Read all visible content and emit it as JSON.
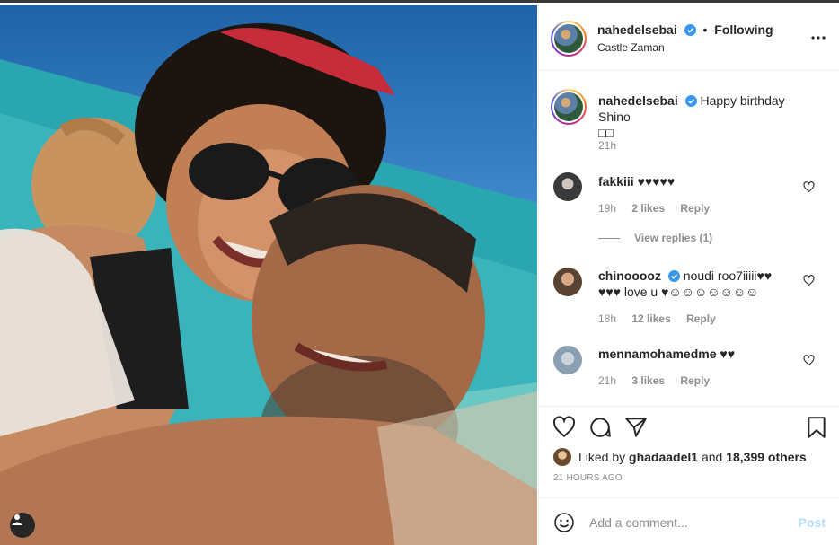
{
  "post": {
    "username": "nahedelsebai",
    "follow_state": "Following",
    "location": "Castle Zaman",
    "caption": "Happy birthday Shino",
    "caption_emoji": "□□",
    "caption_time": "21h"
  },
  "comments": [
    {
      "username": "fakkiii",
      "text": "♥♥♥♥♥",
      "time": "19h",
      "likes": "2 likes",
      "reply": "Reply",
      "view_replies": "View replies (1)"
    },
    {
      "username": "chinooooz",
      "verified": true,
      "text": "noudi roo7iiiii♥♥",
      "text2": "♥♥♥ love u ♥☺☺☺☺☺☺☺",
      "time": "18h",
      "likes": "12 likes",
      "reply": "Reply"
    },
    {
      "username": "mennamohamedme",
      "text": "♥♥",
      "time": "21h",
      "likes": "3 likes",
      "reply": "Reply"
    }
  ],
  "likes": {
    "prefix": "Liked by",
    "user": "ghadaadel1",
    "joiner": "and",
    "others": "18,399 others"
  },
  "time_ago": "21 HOURS AGO",
  "add_comment": {
    "placeholder": "Add a comment...",
    "post_label": "Post"
  },
  "icons": {
    "more": "more-options-icon",
    "like": "heart-icon",
    "comment": "comment-icon",
    "share": "share-icon",
    "save": "bookmark-icon",
    "emoji": "emoji-icon",
    "verified": "verified-badge-icon",
    "user_tag": "user-tag-icon"
  },
  "colors": {
    "verified_blue": "#3897f0",
    "meta_gray": "#8e8e8e",
    "post_disabled": "#b2dffc"
  }
}
